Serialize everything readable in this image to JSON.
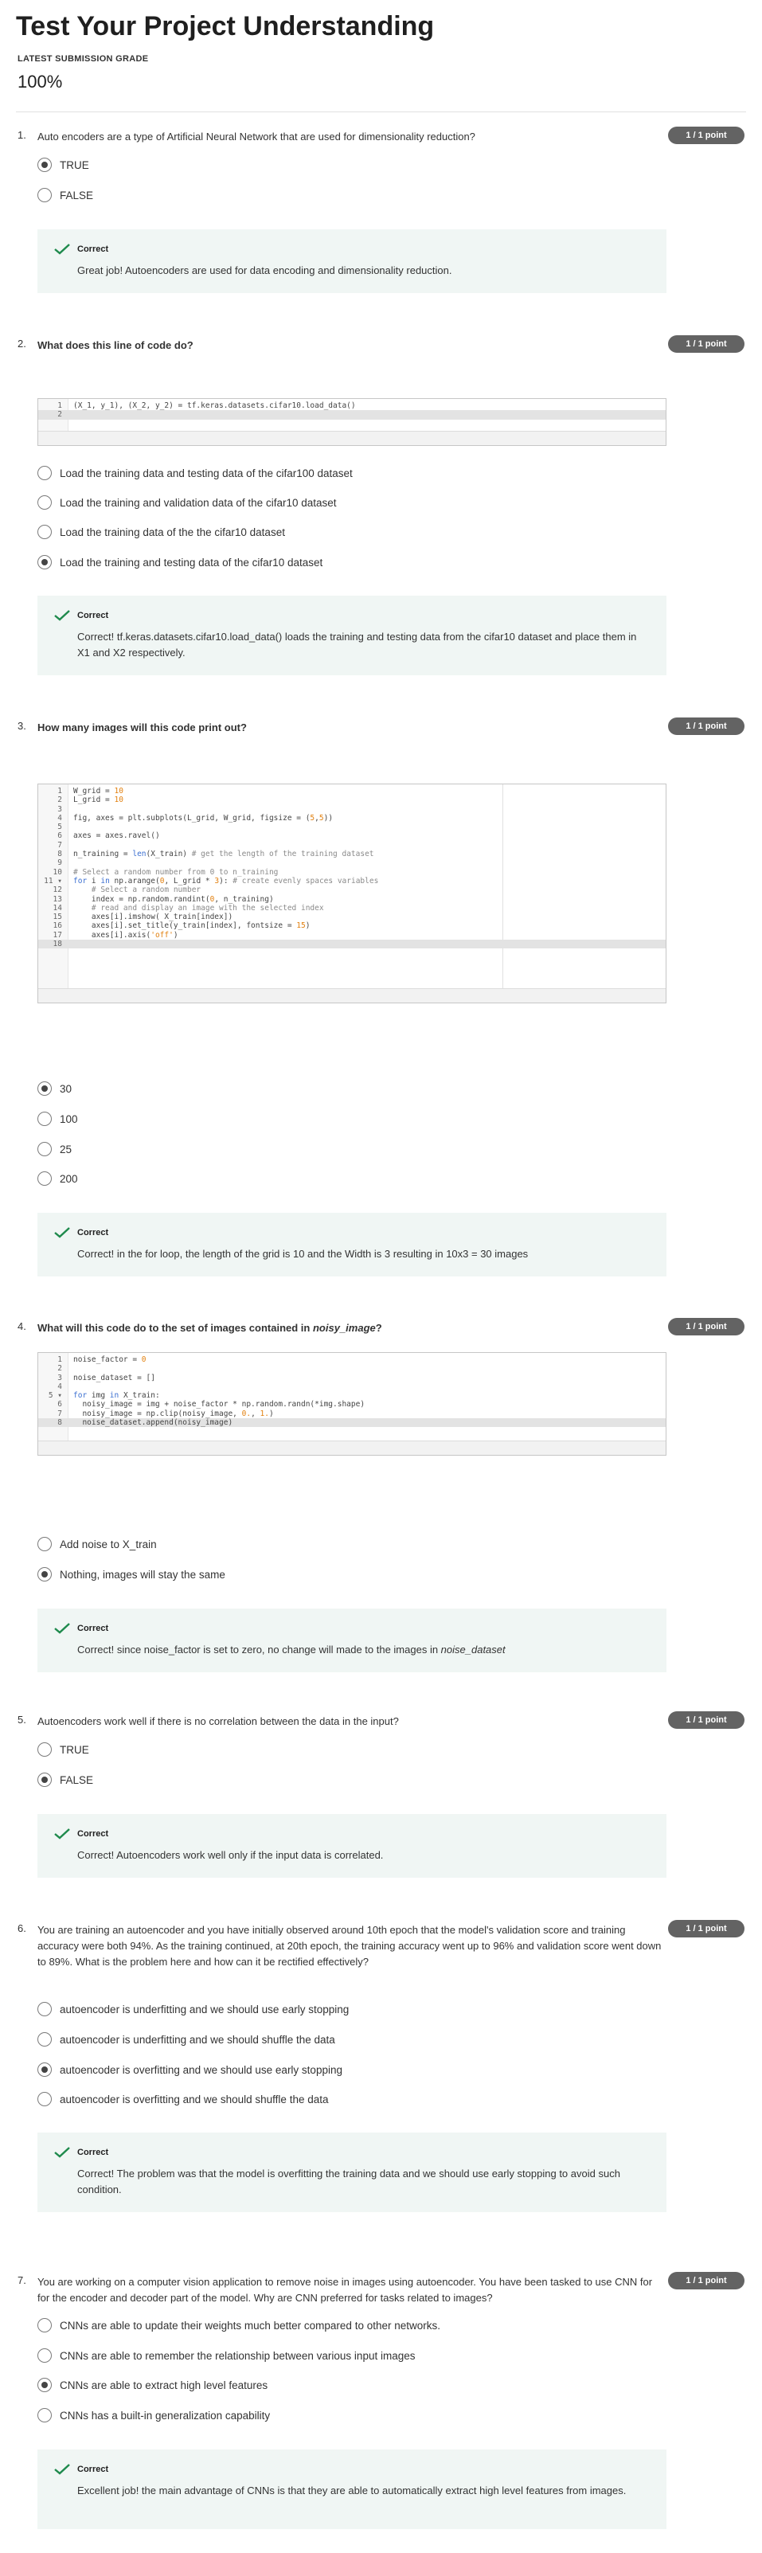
{
  "header": {
    "title": "Test Your Project Understanding",
    "grade_label": "LATEST SUBMISSION GRADE",
    "grade_value": "100%"
  },
  "questions": [
    {
      "number": "1.",
      "text": "Auto encoders are a type of Artificial Neural Network that are used for dimensionality reduction?",
      "points": "1 / 1 point",
      "options": [
        "TRUE",
        "FALSE"
      ],
      "selected_index": 0,
      "feedback": {
        "title": "Correct",
        "text": "Great job! Autoencoders are used for data encoding and dimensionality reduction."
      }
    },
    {
      "number": "2.",
      "text": "What does this line of code do?",
      "points": "1 / 1 point",
      "code": [
        "(X_1, y_1), (X_2, y_2) = tf.keras.datasets.cifar10.load_data()",
        ""
      ],
      "options": [
        "Load the training data and testing data of the cifar100 dataset",
        "Load the training and validation data of the cifar10 dataset",
        "Load the training data of the the cifar10 dataset",
        "Load the training and testing data of the cifar10 dataset"
      ],
      "selected_index": 3,
      "feedback": {
        "title": "Correct",
        "text": "Correct! tf.keras.datasets.cifar10.load_data() loads the training and testing data from the cifar10 dataset and place them in X1 and X2 respectively."
      }
    },
    {
      "number": "3.",
      "text": "How many images will this code print out?",
      "points": "1 / 1 point",
      "code": [
        "W_grid = 10",
        "L_grid = 10",
        "",
        "fig, axes = plt.subplots(L_grid, W_grid, figsize = (5,5))",
        "",
        "axes = axes.ravel()",
        "",
        "n_training = len(X_train) # get the length of the training dataset",
        "",
        "# Select a random number from 0 to n_training",
        "for i in np.arange(0, L_grid * 3): # create evenly spaces variables",
        "    # Select a random number",
        "    index = np.random.randint(0, n_training)",
        "    # read and display an image with the selected index",
        "    axes[i].imshow( X_train[index])",
        "    axes[i].set_title(y_train[index], fontsize = 15)",
        "    axes[i].axis('off')",
        ""
      ],
      "options": [
        "30",
        "100",
        "25",
        "200"
      ],
      "selected_index": 0,
      "feedback": {
        "title": "Correct",
        "text": "Correct! in the for loop, the length of the grid is 10 and the Width is 3 resulting in 10x3 = 30 images"
      }
    },
    {
      "number": "4.",
      "text_before": "What will this code do to the set of images contained in ",
      "text_italic": "noisy_image",
      "text_after": "?",
      "points": "1 / 1 point",
      "code": [
        "noise_factor = 0",
        "",
        "noise_dataset = []",
        "",
        "for img in X_train:",
        "  noisy_image = img + noise_factor * np.random.randn(*img.shape)",
        "  noisy_image = np.clip(noisy_image, 0., 1.)",
        "  noise_dataset.append(noisy_image)"
      ],
      "options": [
        "Add noise to X_train",
        "Nothing, images will stay the same"
      ],
      "selected_index": 1,
      "feedback": {
        "title": "Correct",
        "text_before": "Correct! since noise_factor is set to zero, no change will made to the images in ",
        "text_italic": "noise_dataset"
      }
    },
    {
      "number": "5.",
      "text": "Autoencoders work well if there is no correlation between the data in the input?",
      "points": "1 / 1 point",
      "options": [
        "TRUE",
        "FALSE"
      ],
      "selected_index": 1,
      "feedback": {
        "title": "Correct",
        "text": "Correct! Autoencoders work well only if the input data is correlated."
      }
    },
    {
      "number": "6.",
      "text": "You are training an autoencoder and you have initially observed around 10th epoch that the model's validation score and training accuracy were both 94%. As the training continued, at 20th epoch, the training accuracy went up to 96% and validation score went down to 89%. What is the problem here and how can it be rectified effectively?",
      "points": "1 / 1 point",
      "options": [
        "autoencoder is underfitting and we should use early stopping",
        "autoencoder is underfitting and we should shuffle the data",
        "autoencoder is overfitting and we should use early stopping",
        "autoencoder is overfitting and we should shuffle the data"
      ],
      "selected_index": 2,
      "feedback": {
        "title": "Correct",
        "text": "Correct! The problem was that the model is overfitting the training data and we should use early stopping to avoid such condition."
      }
    },
    {
      "number": "7.",
      "text": "You are working on a computer vision application to remove noise in images using autoencoder. You have been tasked to use CNN for for the encoder and decoder part of the model. Why are CNN preferred for tasks related to images?",
      "points": "1 / 1 point",
      "options": [
        "CNNs are able to update their weights much better compared to other networks.",
        "CNNs are able to remember the relationship between various input images",
        "CNNs are able to extract high level features",
        "CNNs has a built-in generalization capability"
      ],
      "selected_index": 2,
      "feedback": {
        "title": "Correct",
        "text": "Excellent job! the main advantage of CNNs is that they are able to automatically extract high level features from images."
      }
    }
  ],
  "colors": {
    "badge": "#636363",
    "feedback_bg": "#f0f6f4",
    "check": "#1e8a4c"
  }
}
